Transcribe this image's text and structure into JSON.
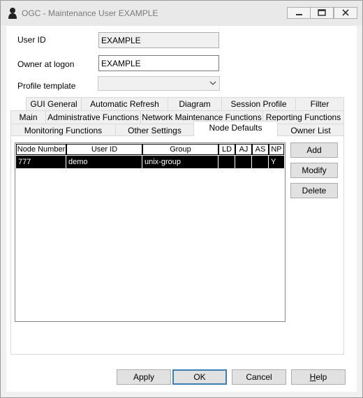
{
  "window": {
    "title": "OGC - Maintenance User EXAMPLE",
    "controls": [
      "minimize-icon",
      "maximize-icon",
      "close-icon"
    ]
  },
  "form": {
    "user_id_label": "User ID",
    "user_id_value": "EXAMPLE",
    "owner_label": "Owner at logon",
    "owner_value": "EXAMPLE",
    "profile_label": "Profile template",
    "profile_value": ""
  },
  "tabs": {
    "row1": [
      "GUI General",
      "Automatic Refresh",
      "Diagram",
      "Session Profile",
      "Filter"
    ],
    "row2": [
      "Main",
      "Administrative Functions",
      "Network Maintenance Functions",
      "Reporting Functions"
    ],
    "row3": [
      "Monitoring Functions",
      "Other Settings",
      "Node Defaults",
      "Owner List"
    ],
    "active": "Node Defaults"
  },
  "table": {
    "columns": [
      "Node Number",
      "User ID",
      "Group",
      "LD",
      "AJ",
      "AS",
      "NP"
    ],
    "rows": [
      [
        "777",
        "demo",
        "unix-group",
        "",
        "",
        "",
        "Y"
      ]
    ]
  },
  "side_buttons": {
    "add": "Add",
    "modify": "Modify",
    "delete": "Delete"
  },
  "footer": {
    "apply": "Apply",
    "ok": "OK",
    "cancel": "Cancel",
    "help_first": "H",
    "help_rest": "elp"
  }
}
